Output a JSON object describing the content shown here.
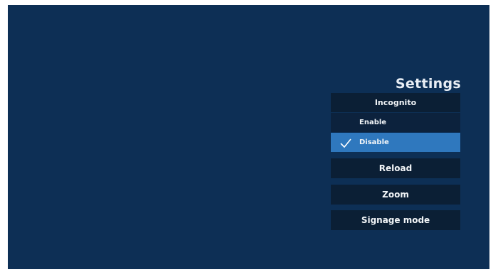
{
  "title": "Settings",
  "incognito": {
    "header": "Incognito",
    "options": [
      {
        "label": "Enable",
        "selected": false
      },
      {
        "label": "Disable",
        "selected": true
      }
    ]
  },
  "menu": {
    "reload": "Reload",
    "zoom": "Zoom",
    "signage_mode": "Signage mode"
  },
  "colors": {
    "background": "#0d2f55",
    "item_background": "#0b1f35",
    "selected": "#2f78be"
  },
  "icons": {
    "selected_marker": "checkmark-icon"
  }
}
